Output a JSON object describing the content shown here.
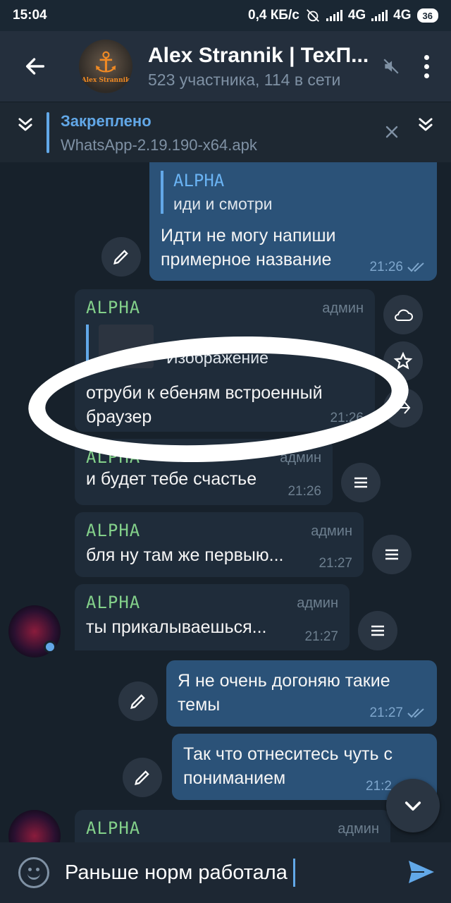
{
  "status_bar": {
    "time": "15:04",
    "net_speed": "0,4 КБ/с",
    "net1": "4G",
    "net2": "4G",
    "battery": "36"
  },
  "header": {
    "title": "Alex Strannik | ТехП...",
    "subtitle": "523 участника, 114 в сети",
    "avatar_text": "Alex Strannik"
  },
  "pinned": {
    "title": "Закреплено",
    "text": "WhatsApp-2.19.190-x64.apk"
  },
  "messages": {
    "m1": {
      "quote_name": "ALPHA",
      "quote_text": "иди и смотри",
      "text": "Идти не могу напиши примерное название",
      "time": "21:26"
    },
    "m2": {
      "name": "ALPHA",
      "role": "админ",
      "quote_text": "Изображение",
      "text": "отруби к ебеням встроенный браузер",
      "time": "21:26"
    },
    "m3": {
      "name": "ALPHA",
      "role": "админ",
      "text": "и будет тебе счастье",
      "time": "21:26"
    },
    "m4": {
      "name": "ALPHA",
      "role": "админ",
      "text": "бля ну там же первыю...",
      "time": "21:27"
    },
    "m5": {
      "name": "ALPHA",
      "role": "админ",
      "text": "ты прикалываешься...",
      "time": "21:27"
    },
    "m6": {
      "text": "Я не очень догоняю такие темы",
      "time": "21:27"
    },
    "m7": {
      "text": "Так что отнеситесь чуть с пониманием",
      "time": "21:2"
    },
    "m8": {
      "name": "ALPHA",
      "role": "админ"
    }
  },
  "composer": {
    "value": "Раньше норм работала"
  },
  "colors": {
    "background": "#17212b",
    "outgoing_bubble": "#2b5278",
    "incoming_bubble": "#1f2c3a",
    "accent": "#62a8e8",
    "name_green": "#83d08a"
  }
}
